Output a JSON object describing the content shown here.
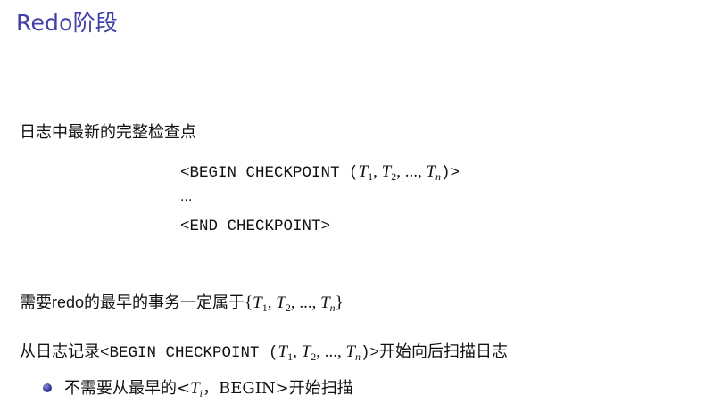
{
  "title": "Redo阶段",
  "line1": "日志中最新的完整检查点",
  "checkpoint": {
    "begin_prefix": "<BEGIN CHECKPOINT (",
    "t": "T",
    "sub1": "1",
    "sub2": "2",
    "subn": "n",
    "comma": ", ",
    "dots": "...",
    "begin_suffix": ")>",
    "ellipsis": "...",
    "end": "<END CHECKPOINT>"
  },
  "line2": {
    "prefix": "需要",
    "redo": "redo",
    "suffix": "的最早的事务一定属于",
    "open_brace": "{",
    "close_brace": "}"
  },
  "line3": {
    "prefix": "从日志记录",
    "suffix": "开始向后扫描日志"
  },
  "bullet": {
    "prefix": "不需要从最早的<",
    "sub_i": "i",
    "suffix": "，BEGIN>开始扫描"
  }
}
